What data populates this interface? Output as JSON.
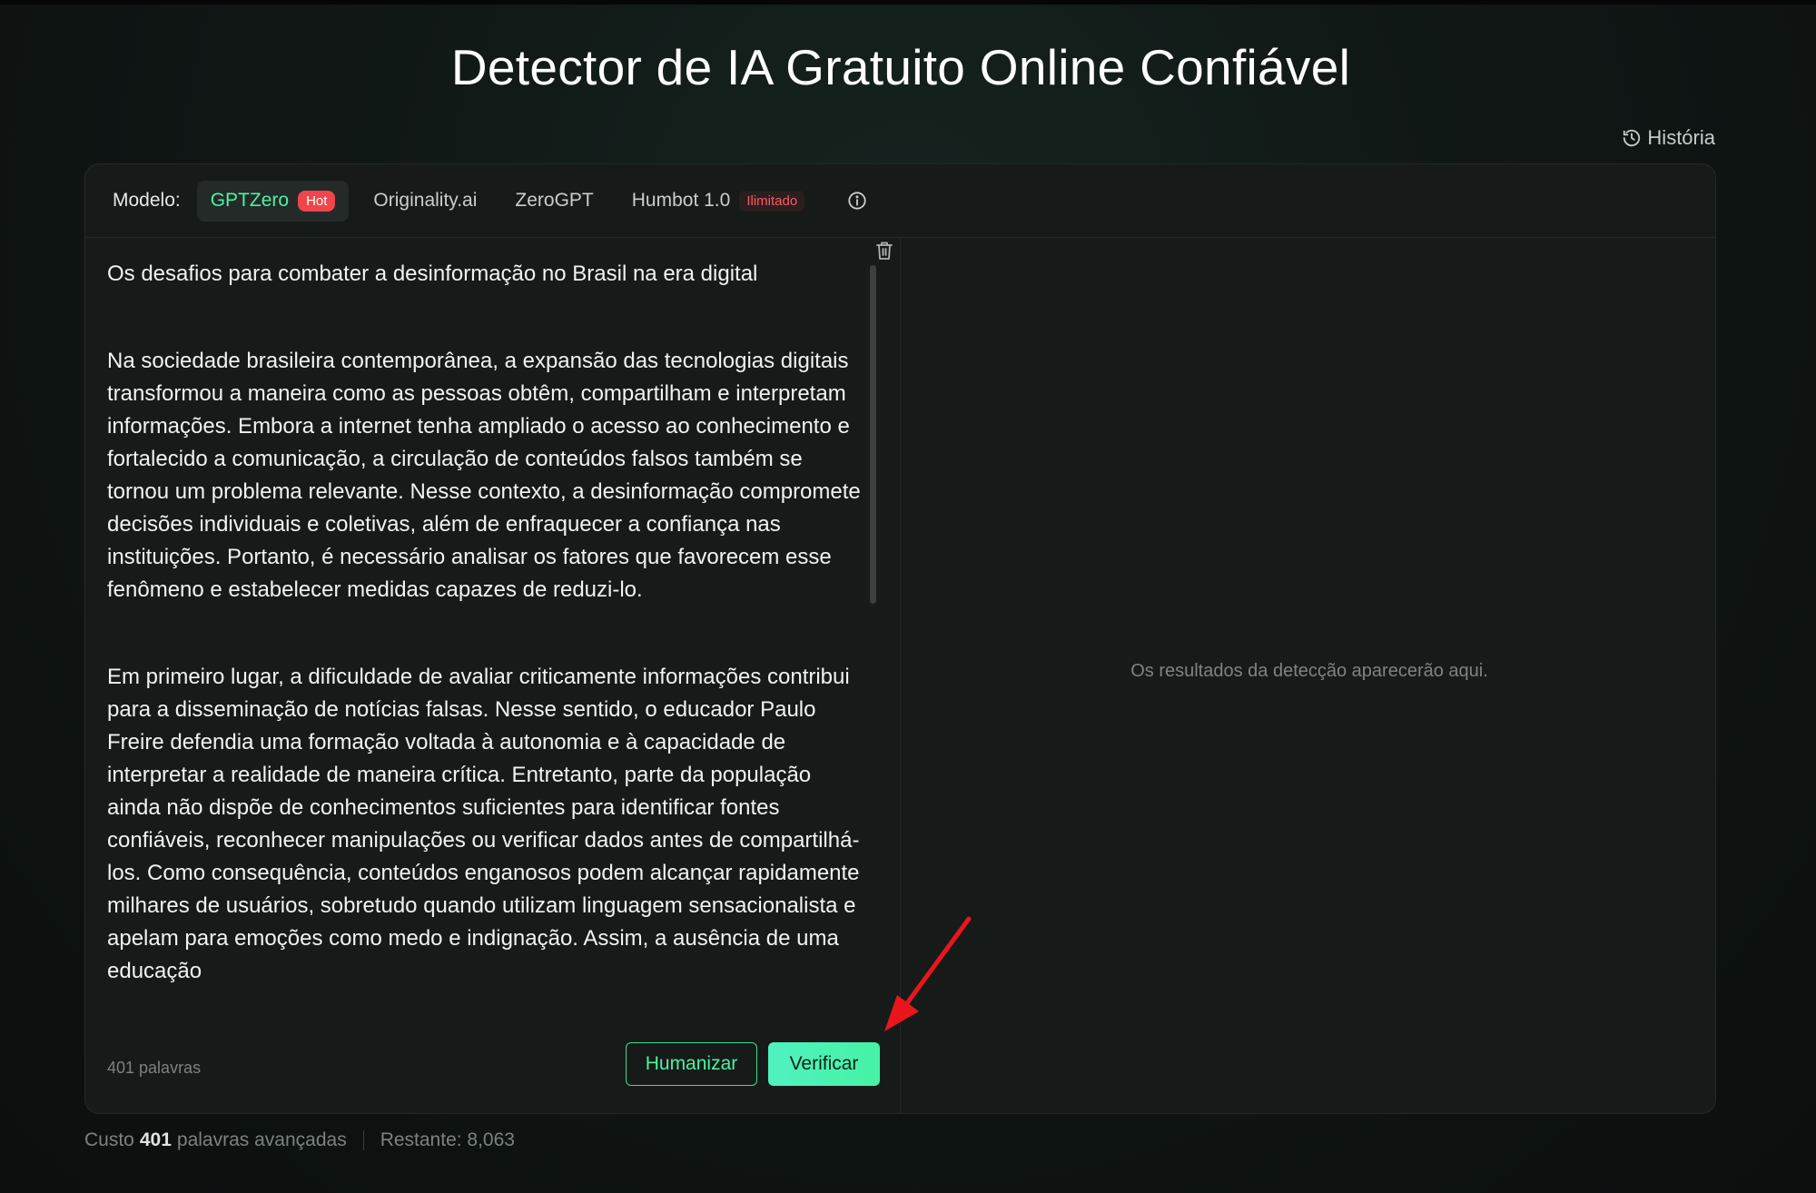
{
  "page": {
    "title": "Detector de IA Gratuito Online Confiável",
    "history_label": "História"
  },
  "model_bar": {
    "label": "Modelo:",
    "tabs": [
      {
        "label": "GPTZero",
        "badge": "Hot",
        "active": true
      },
      {
        "label": "Originality.ai"
      },
      {
        "label": "ZeroGPT"
      },
      {
        "label": "Humbot 1.0",
        "badge": "Ilimitado"
      }
    ]
  },
  "editor": {
    "paragraphs": [
      "Os desafios para combater a desinformação no Brasil na era digital",
      "Na sociedade brasileira contemporânea, a expansão das tecnologias digitais transformou a maneira como as pessoas obtêm, compartilham e interpretam informações. Embora a internet tenha ampliado o acesso ao conhecimento e fortalecido a comunicação, a circulação de conteúdos falsos também se tornou um problema relevante. Nesse contexto, a desinformação compromete decisões individuais e coletivas, além de enfraquecer a confiança nas instituições. Portanto, é necessário analisar os fatores que favorecem esse fenômeno e estabelecer medidas capazes de reduzi-lo.",
      "Em primeiro lugar, a dificuldade de avaliar criticamente informações contribui para a disseminação de notícias falsas. Nesse sentido, o educador Paulo Freire defendia uma formação voltada à autonomia e à capacidade de interpretar a realidade de maneira crítica. Entretanto, parte da população ainda não dispõe de conhecimentos suficientes para identificar fontes confiáveis, reconhecer manipulações ou verificar dados antes de compartilhá-los. Como consequência, conteúdos enganosos podem alcançar rapidamente milhares de usuários, sobretudo quando utilizam linguagem sensacionalista e apelam para emoções como medo e indignação. Assim, a ausência de uma educação"
    ],
    "word_count": "401 palavras",
    "humanize_label": "Humanizar",
    "verify_label": "Verificar"
  },
  "results": {
    "placeholder": "Os resultados da detecção aparecerão aqui."
  },
  "footer": {
    "cost_prefix": "Custo",
    "cost_value": "401",
    "cost_suffix": "palavras avançadas",
    "remaining": "Restante: 8,063"
  },
  "colors": {
    "accent_green": "#4ef2a0",
    "hot_badge": "#f0454a",
    "annotation_arrow": "#e8161b"
  }
}
